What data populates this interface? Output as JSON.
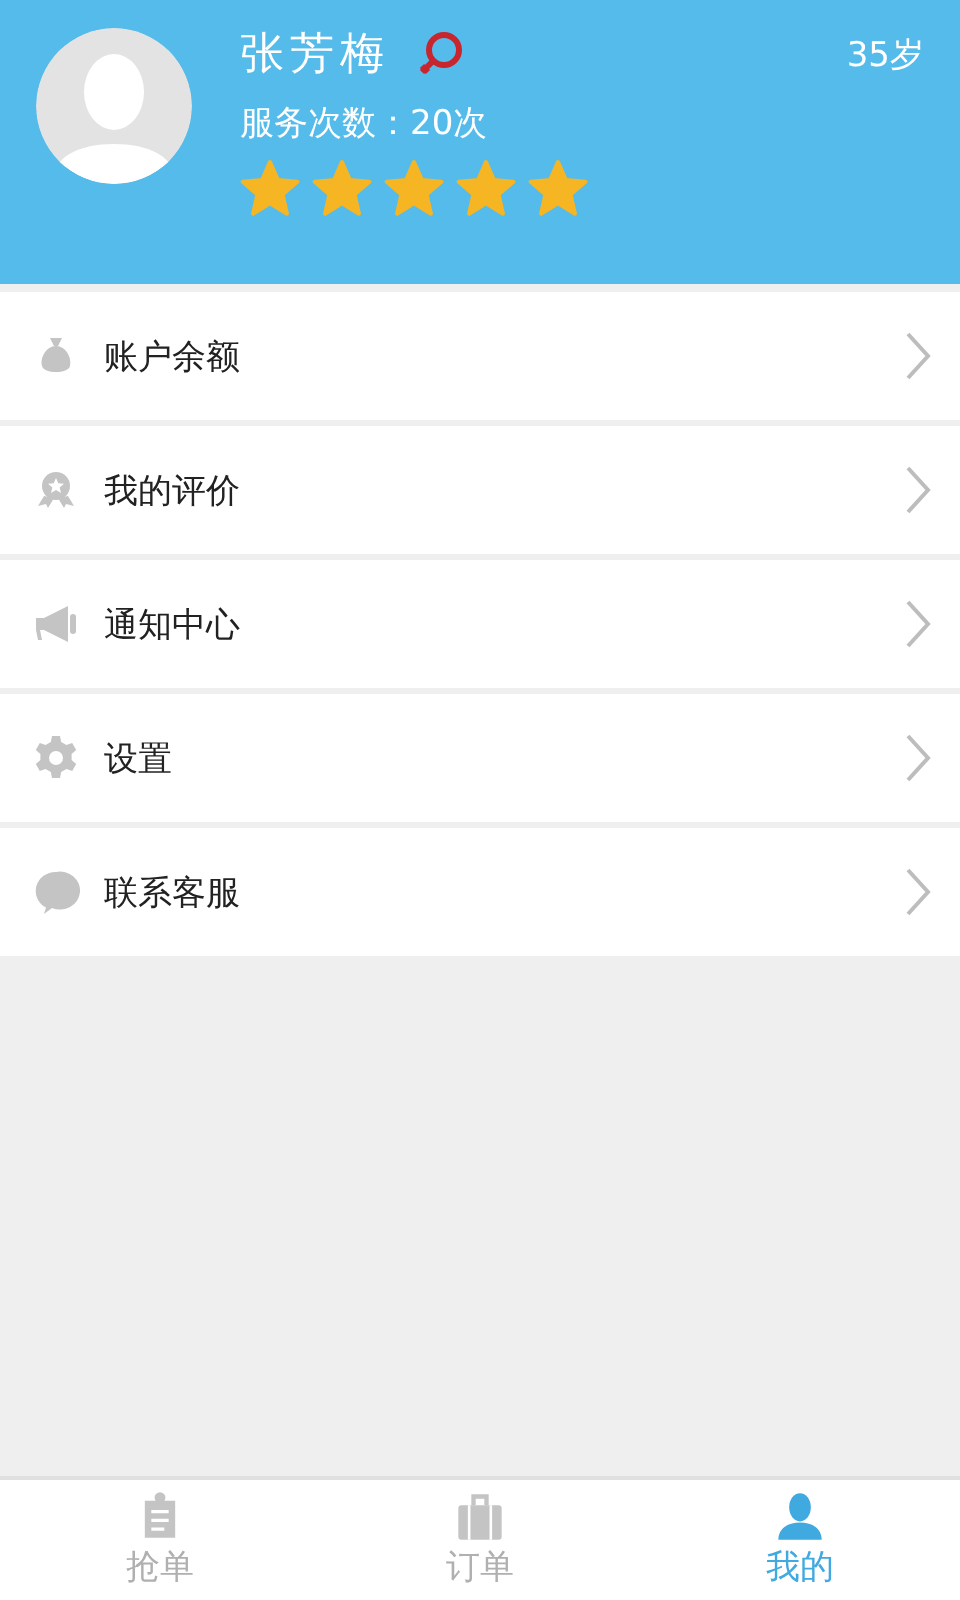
{
  "profile": {
    "name": "张芳梅",
    "female": true,
    "age": "35岁",
    "service_count": "服务次数：20次",
    "stars": 5
  },
  "menu": [
    {
      "kind": "money",
      "label": "账户余额"
    },
    {
      "kind": "medal",
      "label": "我的评价"
    },
    {
      "kind": "megaphone",
      "label": "通知中心"
    },
    {
      "kind": "gear",
      "label": "设置"
    },
    {
      "kind": "chat",
      "label": "联系客服"
    }
  ],
  "tabs": [
    {
      "kind": "clipboard",
      "label": "抢单",
      "selected": false
    },
    {
      "kind": "briefcase",
      "label": "订单",
      "selected": false
    },
    {
      "kind": "person",
      "label": "我的",
      "selected": true
    }
  ]
}
